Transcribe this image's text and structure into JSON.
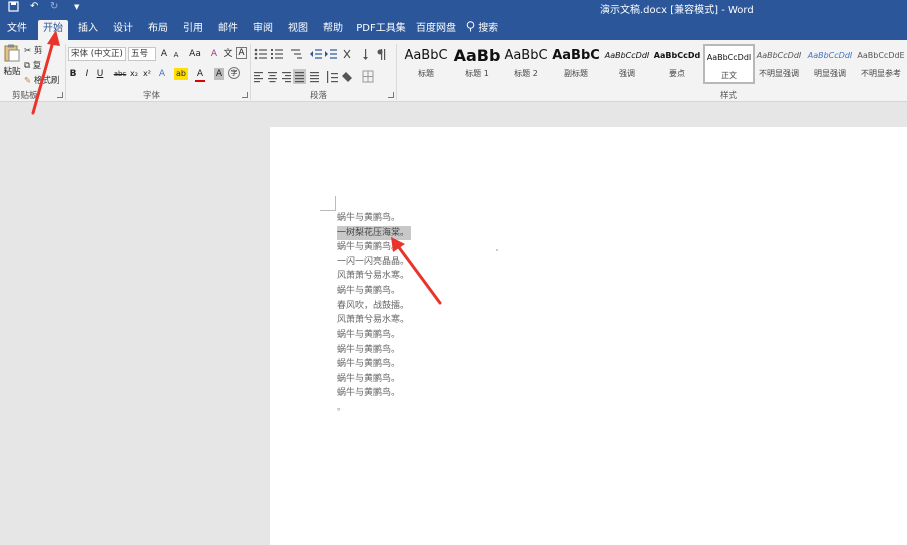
{
  "titlebar": {
    "title": "演示文稿.docx [兼容模式] - Word",
    "save_icon": "save-icon",
    "undo_icon": "undo-icon",
    "redo_icon": "redo-icon",
    "customize_icon": "customize-quick-access-icon"
  },
  "tabs": [
    "文件",
    "开始",
    "插入",
    "设计",
    "布局",
    "引用",
    "邮件",
    "审阅",
    "视图",
    "帮助",
    "PDF工具集",
    "百度网盘"
  ],
  "active_tab": "开始",
  "tell_me": "搜索",
  "clipboard": {
    "paste": "粘贴",
    "cut": "剪",
    "copy": "复",
    "format_painter": "格式刷",
    "label": "剪贴板"
  },
  "font": {
    "name": "宋体 (中文正)",
    "size": "五号",
    "grow": "A",
    "shrink": "A",
    "case": "Aa",
    "clear": "A",
    "phonetic": "文",
    "border_char": "A",
    "bold": "B",
    "italic": "I",
    "underline": "U",
    "strike": "abc",
    "subscript": "x₂",
    "superscript": "x²",
    "text_effect": "A",
    "highlight": "ab",
    "font_color": "A",
    "char_shading": "A",
    "enclose": "字",
    "label": "字体"
  },
  "paragraph": {
    "label": "段落"
  },
  "styles": {
    "label": "样式",
    "items": [
      {
        "sample": "AaBbC",
        "name": "标题"
      },
      {
        "sample": "AaBb",
        "name": "标题 1"
      },
      {
        "sample": "AaBbC",
        "name": "标题 2"
      },
      {
        "sample": "AaBbC",
        "name": "副标题"
      },
      {
        "sample": "AaBbCcDdI",
        "name": "强调"
      },
      {
        "sample": "AaBbCcDd",
        "name": "要点"
      },
      {
        "sample": "AaBbCcDdI",
        "name": "正文"
      },
      {
        "sample": "AaBbCcDdI",
        "name": "不明显强调"
      },
      {
        "sample": "AaBbCcDdI",
        "name": "明显强调"
      },
      {
        "sample": "AaBbCcDdE",
        "name": "不明显参考"
      }
    ],
    "selected": "正文"
  },
  "document": {
    "lines": [
      "蜗牛与黄鹂鸟。",
      "一树梨花压海棠。",
      "蜗牛与黄鹂鸟。",
      "一闪一闪亮晶晶。",
      "风萧萧兮易水寒。",
      "蜗牛与黄鹂鸟。",
      "春风吹，战鼓擂。",
      "风萧萧兮易水寒。",
      "蜗牛与黄鹂鸟。",
      "蜗牛与黄鹂鸟。",
      "蜗牛与黄鹂鸟。",
      "蜗牛与黄鹂鸟。",
      "蜗牛与黄鹂鸟。",
      "。"
    ],
    "selected_line": 1
  },
  "colors": {
    "brand": "#2b579a",
    "annotation": "#e8342a",
    "ribbon": "#f3f3f3",
    "selection": "#c8c8c8"
  }
}
